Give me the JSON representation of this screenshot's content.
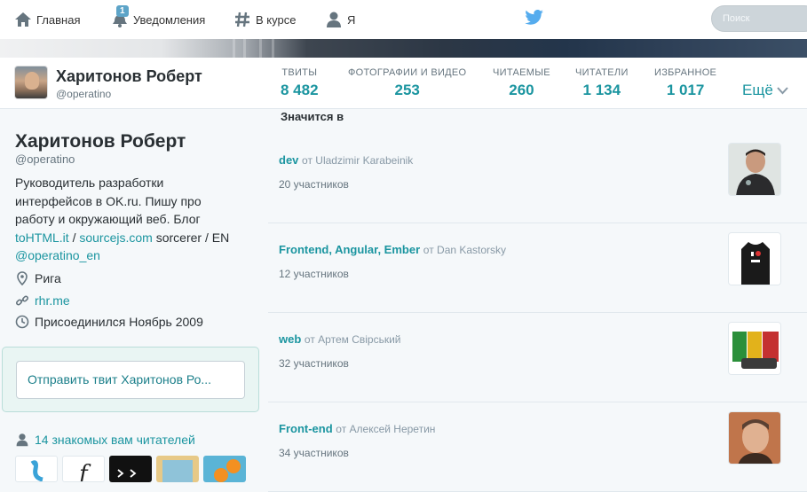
{
  "nav": {
    "home": "Главная",
    "notifications": "Уведомления",
    "notifications_badge": "1",
    "discover": "В курсе",
    "me": "Я",
    "search_placeholder": "Поиск"
  },
  "profile": {
    "name": "Харитонов Роберт",
    "handle": "@operatino",
    "stats": [
      {
        "label": "ТВИТЫ",
        "value": "8 482"
      },
      {
        "label": "ФОТОГРАФИИ И ВИДЕО",
        "value": "253"
      },
      {
        "label": "ЧИТАЕМЫЕ",
        "value": "260"
      },
      {
        "label": "ЧИТАТЕЛИ",
        "value": "1 134"
      },
      {
        "label": "ИЗБРАННОЕ",
        "value": "1 017"
      }
    ],
    "more": "Ещё",
    "bio_line1": "Руководитель разработки",
    "bio_line2": "интерфейсов в OK.ru. Пишу про",
    "bio_line3": "работу и окружающий веб. Блог",
    "bio_link1": "toHTML.it",
    "bio_sep": " / ",
    "bio_link2": "sourcejs.com",
    "bio_tail": " sorcerer / EN",
    "bio_link3": "@operatino_en",
    "location": "Рига",
    "website": "rhr.me",
    "joined": "Присоединился Ноябрь 2009",
    "tweet_button": "Отправить твит Харитонов Ро...",
    "followers_you_know": "14 знакомых вам читателей"
  },
  "lists": {
    "title": "Значится в",
    "items": [
      {
        "name": "dev",
        "by": "от Uladzimir Karabeinik",
        "members": "20 участников"
      },
      {
        "name": "Frontend, Angular, Ember",
        "by": "от Dan Kastorsky",
        "members": "12 участников"
      },
      {
        "name": "web",
        "by": "от Артем Свірський",
        "members": "32 участников"
      },
      {
        "name": "Front-end",
        "by": "от Алексей Неретин",
        "members": "34 участников"
      }
    ]
  },
  "icons": {
    "home": "home-icon",
    "notifications": "bell-icon",
    "discover": "hash-icon",
    "me": "user-icon",
    "logo": "twitter-bird-icon",
    "location": "map-pin-icon",
    "website": "link-icon",
    "joined": "calendar-icon",
    "followers": "user-icon"
  },
  "colors": {
    "accent": "#1b95a0",
    "text": "#292f33",
    "muted": "#66757f",
    "background": "#f5f8fa"
  }
}
